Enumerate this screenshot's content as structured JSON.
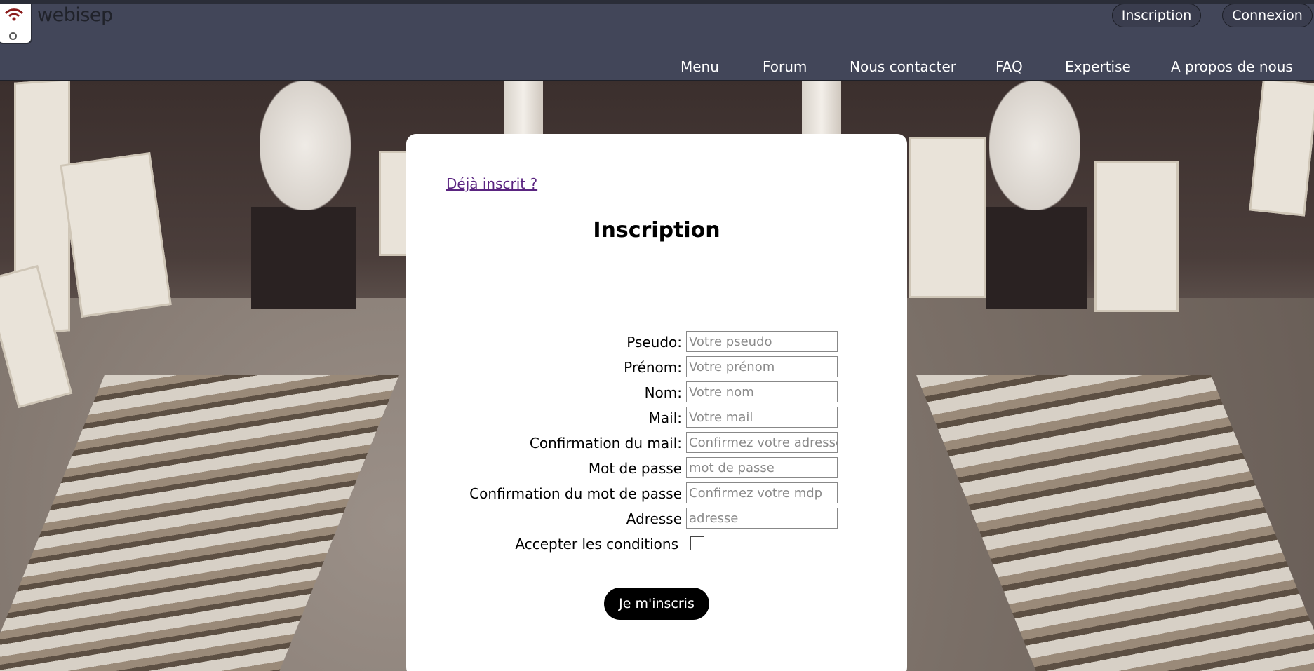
{
  "brand": {
    "name": "webisep",
    "logo_icon": "wifi-icon"
  },
  "auth": {
    "inscription": "Inscription",
    "connexion": "Connexion"
  },
  "nav": {
    "items": [
      {
        "label": "Menu"
      },
      {
        "label": "Forum"
      },
      {
        "label": "Nous contacter"
      },
      {
        "label": "FAQ"
      },
      {
        "label": "Expertise"
      },
      {
        "label": "A propos de nous"
      }
    ]
  },
  "form": {
    "already_link": "Déjà inscrit ?",
    "title": "Inscription",
    "fields": [
      {
        "label": "Pseudo:",
        "placeholder": "Votre pseudo",
        "value": ""
      },
      {
        "label": "Prénom:",
        "placeholder": "Votre prénom",
        "value": ""
      },
      {
        "label": "Nom:",
        "placeholder": "Votre nom",
        "value": ""
      },
      {
        "label": "Mail:",
        "placeholder": "Votre mail",
        "value": ""
      },
      {
        "label": "Confirmation du mail:",
        "placeholder": "Confirmez votre adresse",
        "value": ""
      },
      {
        "label": "Mot de passe",
        "placeholder": "mot de passe",
        "value": ""
      },
      {
        "label": "Confirmation du mot de passe",
        "placeholder": "Confirmez votre mdp",
        "value": ""
      },
      {
        "label": "Adresse",
        "placeholder": "adresse",
        "value": ""
      }
    ],
    "conditions_label": "Accepter les conditions",
    "conditions_checked": false,
    "submit_label": "Je m'inscris"
  },
  "colors": {
    "header_bg": "#424659",
    "link": "#5a2480",
    "button_bg": "#000000"
  }
}
